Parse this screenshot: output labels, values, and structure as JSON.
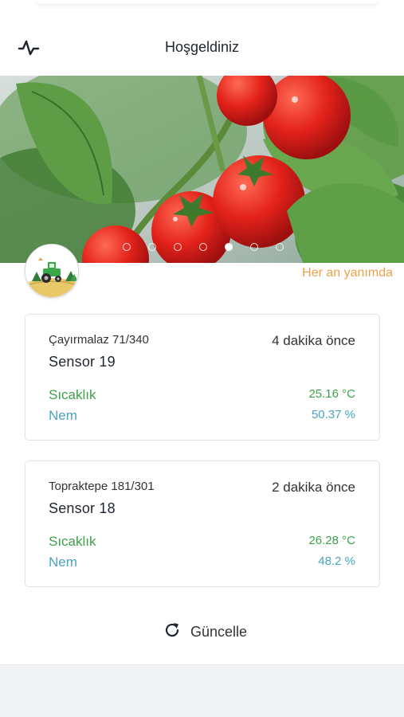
{
  "header": {
    "title": "Hoşgeldiniz",
    "menu_icon": "pulse-icon"
  },
  "hero": {
    "image": "tomato-plant-photo",
    "slide_count": 7,
    "active_slide": 5
  },
  "brand": {
    "logo": "farm-tractor-logo",
    "tagline": "Her an yanımda"
  },
  "sensors": [
    {
      "location": "Çayırmalaz 71/340",
      "name": "Sensor 19",
      "time_ago": "4 dakika önce",
      "temp_label": "Sıcaklık",
      "temp_value": "25.16 °C",
      "humidity_label": "Nem",
      "humidity_value": "50.37 %"
    },
    {
      "location": "Topraktepe 181/301",
      "name": "Sensor 18",
      "time_ago": "2 dakika önce",
      "temp_label": "Sıcaklık",
      "temp_value": "26.28 °C",
      "humidity_label": "Nem",
      "humidity_value": "48.2 %"
    }
  ],
  "actions": {
    "refresh_label": "Güncelle",
    "refresh_icon": "refresh-icon"
  },
  "colors": {
    "temperature": "#3fa14a",
    "humidity": "#4aa3bf",
    "tagline": "#f0a04b"
  }
}
